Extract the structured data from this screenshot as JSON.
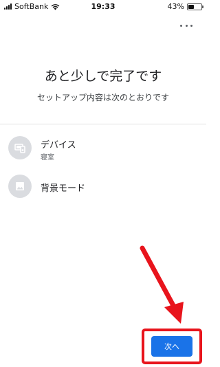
{
  "status_bar": {
    "carrier": "SoftBank",
    "time": "19:33",
    "battery_text": "43%",
    "battery_level": 0.43
  },
  "header": {
    "more_icon": "more-horiz-icon"
  },
  "main": {
    "title": "あと少しで完了です",
    "subtitle": "セットアップ内容は次のとおりです"
  },
  "settings": [
    {
      "label": "デバイス",
      "sublabel": "寝室",
      "icon": "device-speaker-icon"
    },
    {
      "label": "背景モード",
      "icon": "image-icon"
    }
  ],
  "footer": {
    "next_label": "次へ"
  },
  "colors": {
    "accent": "#1a73e8",
    "annotation": "#e8141c",
    "icon_circle": "#dadce0"
  }
}
